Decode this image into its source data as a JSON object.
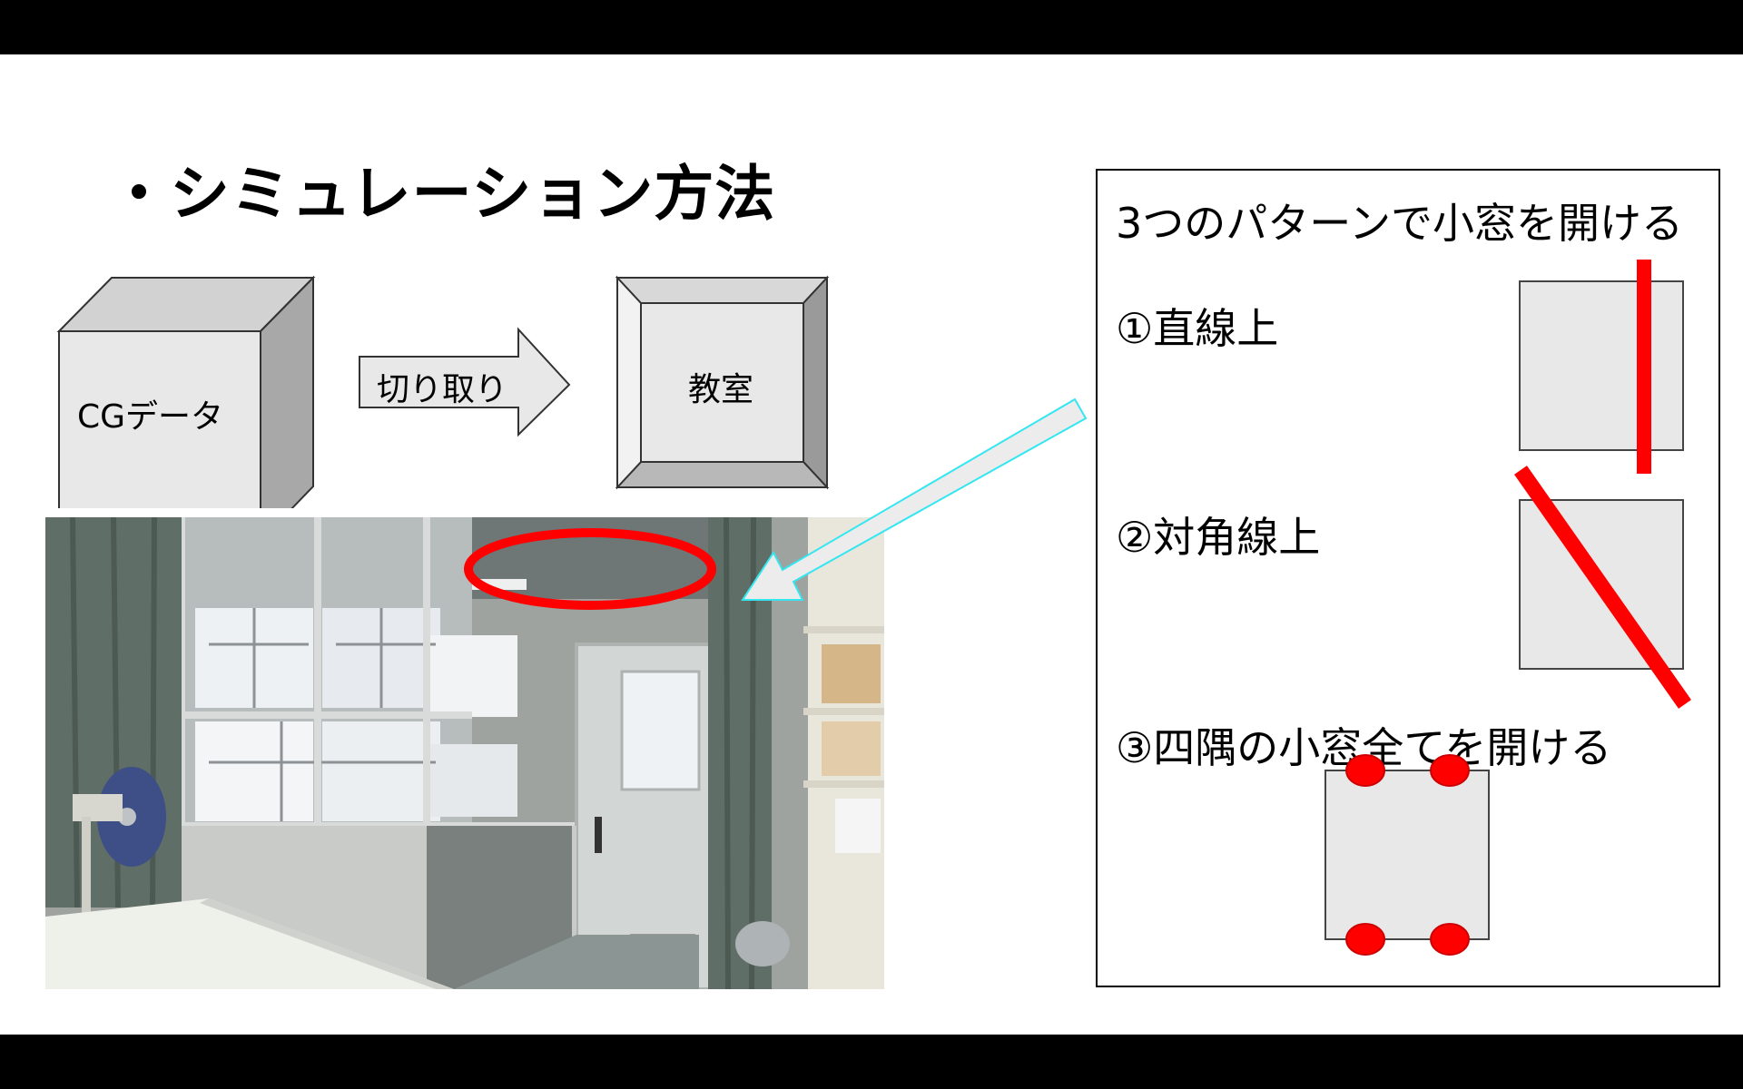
{
  "slide": {
    "title": "・シミュレーション方法",
    "cg_box_label": "CGデータ",
    "arrow_label": "切り取り",
    "room_box_label": "教室"
  },
  "panel": {
    "heading": "3つのパターンで小窓を開ける",
    "pattern1": "①直線上",
    "pattern2": "②対角線上",
    "pattern3": "③四隅の小窓全てを開ける"
  },
  "colors": {
    "accent_red": "#ff0000",
    "box_fill": "#e8e8e8",
    "callout_outline": "#33e6f0"
  },
  "icons": {
    "photo": "classroom-photo"
  }
}
